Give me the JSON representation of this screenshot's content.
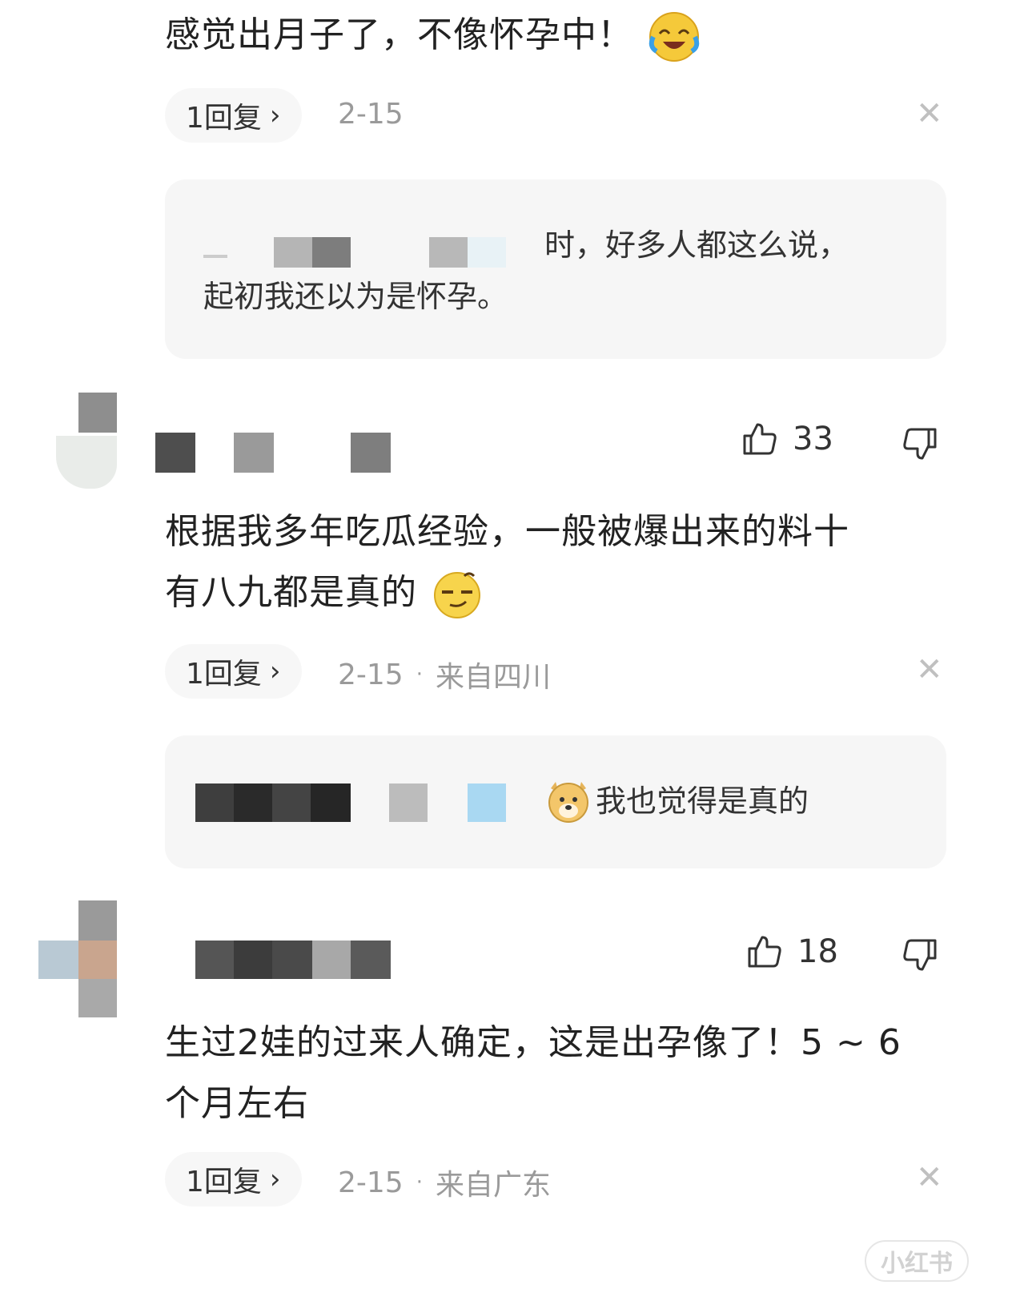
{
  "comment1": {
    "text": "感觉出月子了，不像怀孕中！",
    "reply_label": "1回复",
    "date": "2-15",
    "sub_reply": {
      "line1": "时，好多人都这么说，",
      "line2": "起初我还以为是怀孕。"
    }
  },
  "comment2": {
    "likes": "33",
    "text_line1": "根据我多年吃瓜经验，一般被爆出来的料十",
    "text_line2": "有八九都是真的",
    "reply_label": "1回复",
    "date": "2-15",
    "location": "来自四川",
    "sub_reply": {
      "text": "我也觉得是真的"
    }
  },
  "comment3": {
    "likes": "18",
    "text_line1": "生过2娃的过来人确定，这是出孕像了！5 ~ 6",
    "text_line2": "个月左右",
    "reply_label": "1回复",
    "date": "2-15",
    "location": "来自广东"
  },
  "watermark": "小红书",
  "icons": {
    "like": "thumbs-up-icon",
    "dislike": "thumbs-down-icon",
    "close": "close-icon",
    "chevron": "chevron-right-icon"
  }
}
